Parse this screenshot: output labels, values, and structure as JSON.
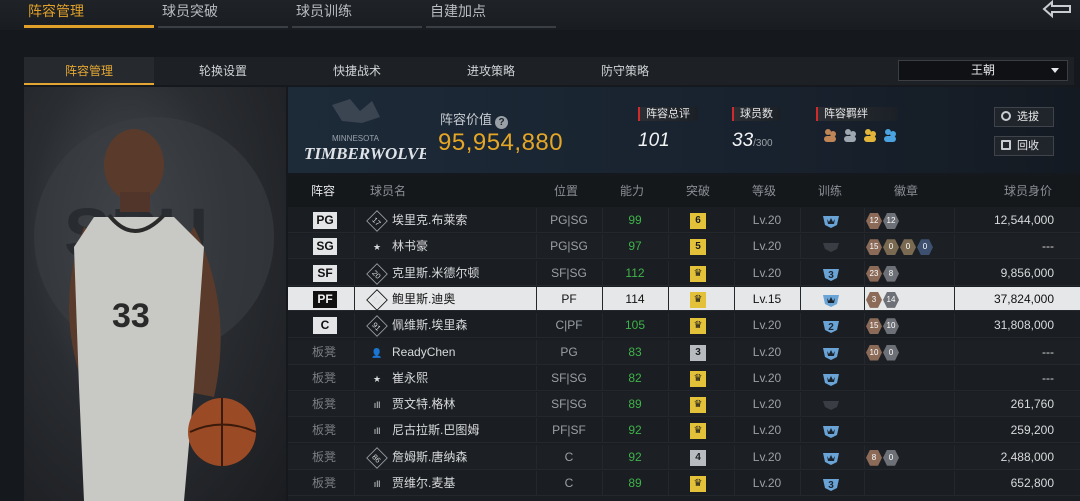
{
  "top_tabs": [
    "阵容管理",
    "球员突破",
    "球员训练",
    "自建加点"
  ],
  "sub_tabs": [
    "阵容管理",
    "轮换设置",
    "快捷战术",
    "进攻策略",
    "防守策略"
  ],
  "team_select": "王朝",
  "header": {
    "logo_text_top": "MINNESOTA",
    "logo_text": "TIMBERWOLVES",
    "value_label": "阵容价值",
    "value": "95,954,880",
    "rating_label": "阵容总评",
    "rating": "101",
    "players_label": "球员数",
    "players": "33",
    "players_max": "/300",
    "bond_label": "阵容羁绊",
    "filter_btn": "选拔",
    "recycle_btn": "回收"
  },
  "columns": [
    "阵容",
    "球员名",
    "位置",
    "能力",
    "突破",
    "等级",
    "训练",
    "徽章",
    "球员身价"
  ],
  "rows": [
    {
      "slot": "PG",
      "num": "17",
      "name": "埃里克.布莱索",
      "pos": "PG|SG",
      "ability": "99",
      "brk": "6",
      "brk_type": "gold",
      "level": "Lv.20",
      "train": "blue",
      "badges": [
        {
          "t": "12",
          "c": "#8b6a58"
        },
        {
          "t": "12",
          "c": "#6d7076"
        }
      ],
      "value": "12,544,000"
    },
    {
      "slot": "SG",
      "num": "★",
      "name": "林书豪",
      "pos": "PG|SG",
      "ability": "97",
      "brk": "5",
      "brk_type": "gold",
      "level": "Lv.20",
      "train": "dark",
      "badges": [
        {
          "t": "15",
          "c": "#8b6a58"
        },
        {
          "t": "0",
          "c": "#7a6a52"
        },
        {
          "t": "0",
          "c": "#7a6a52"
        },
        {
          "t": "0",
          "c": "#3d5070"
        }
      ],
      "value": "---"
    },
    {
      "slot": "SF",
      "num": "20",
      "name": "克里斯.米德尔顿",
      "pos": "SF|SG",
      "ability": "112",
      "brk": "♛",
      "brk_type": "gold",
      "level": "Lv.20",
      "train": "blue3",
      "badges": [
        {
          "t": "23",
          "c": "#8b6a58"
        },
        {
          "t": "8",
          "c": "#6d7076"
        }
      ],
      "value": "9,856,000"
    },
    {
      "slot": "PF",
      "num": "13",
      "name": "鲍里斯.迪奥",
      "pos": "PF",
      "ability": "114",
      "brk": "♛",
      "brk_type": "gold",
      "level": "Lv.15",
      "train": "blue",
      "badges": [
        {
          "t": "3",
          "c": "#8b6a58"
        },
        {
          "t": "14",
          "c": "#6d7076"
        }
      ],
      "value": "37,824,000",
      "sel": true
    },
    {
      "slot": "C",
      "num": "91",
      "name": "佩维斯.埃里森",
      "pos": "C|PF",
      "ability": "105",
      "brk": "♛",
      "brk_type": "gold",
      "level": "Lv.20",
      "train": "blue2",
      "badges": [
        {
          "t": "15",
          "c": "#8b6a58"
        },
        {
          "t": "10",
          "c": "#6d7076"
        }
      ],
      "value": "31,808,000"
    },
    {
      "slot": "板凳",
      "num": "👤",
      "name": "ReadyChen",
      "pos": "PG",
      "ability": "83",
      "brk": "3",
      "brk_type": "grey",
      "level": "Lv.20",
      "train": "blue",
      "badges": [
        {
          "t": "10",
          "c": "#8b6a58"
        },
        {
          "t": "0",
          "c": "#6d7076"
        }
      ],
      "value": "---"
    },
    {
      "slot": "板凳",
      "num": "★",
      "name": "崔永熙",
      "pos": "SF|SG",
      "ability": "82",
      "brk": "♛",
      "brk_type": "gold",
      "level": "Lv.20",
      "train": "blue",
      "badges": [],
      "value": "---"
    },
    {
      "slot": "板凳",
      "num": "ıll",
      "name": "贾文特.格林",
      "pos": "SF|SG",
      "ability": "89",
      "brk": "♛",
      "brk_type": "gold",
      "level": "Lv.20",
      "train": "dark",
      "badges": [],
      "value": "261,760"
    },
    {
      "slot": "板凳",
      "num": "ıll",
      "name": "尼古拉斯.巴图姆",
      "pos": "PF|SF",
      "ability": "92",
      "brk": "♛",
      "brk_type": "gold",
      "level": "Lv.20",
      "train": "blue",
      "badges": [],
      "value": "259,200"
    },
    {
      "slot": "板凳",
      "num": "86",
      "name": "詹姆斯.唐纳森",
      "pos": "C",
      "ability": "92",
      "brk": "4",
      "brk_type": "grey",
      "level": "Lv.20",
      "train": "blue",
      "badges": [
        {
          "t": "8",
          "c": "#8b6a58"
        },
        {
          "t": "0",
          "c": "#6d7076"
        }
      ],
      "value": "2,488,000"
    },
    {
      "slot": "板凳",
      "num": "ıll",
      "name": "贾维尔.麦基",
      "pos": "C",
      "ability": "89",
      "brk": "♛",
      "brk_type": "gold",
      "level": "Lv.20",
      "train": "blue3",
      "badges": [],
      "value": "652,800"
    }
  ],
  "colors": {
    "accent": "#e3a632",
    "value_gold": "#e5a626",
    "ability_green": "#3fb34a",
    "red_marker": "#d02a2a"
  }
}
